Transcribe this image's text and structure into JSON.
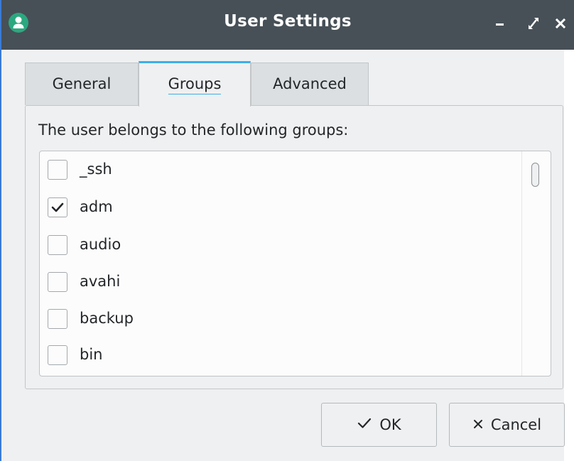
{
  "window": {
    "title": "User Settings"
  },
  "titlebar": {
    "app_icon": "user-icon",
    "minimize_icon": "minimize-icon",
    "maximize_icon": "maximize-icon",
    "close_icon": "close-icon"
  },
  "tabs": [
    {
      "label": "General",
      "active": false
    },
    {
      "label": "Groups",
      "active": true
    },
    {
      "label": "Advanced",
      "active": false
    }
  ],
  "groups_panel": {
    "caption": "The user belongs to the following groups:",
    "items": [
      {
        "label": "_ssh",
        "checked": false
      },
      {
        "label": "adm",
        "checked": true
      },
      {
        "label": "audio",
        "checked": false
      },
      {
        "label": "avahi",
        "checked": false
      },
      {
        "label": "backup",
        "checked": false
      },
      {
        "label": "bin",
        "checked": false
      }
    ]
  },
  "buttons": {
    "ok_label": "OK",
    "ok_icon": "checkmark-icon",
    "cancel_label": "Cancel",
    "cancel_icon": "x-icon"
  },
  "colors": {
    "titlebar": "#475057",
    "accent": "#3daee9",
    "app_icon": "#2ba87f"
  }
}
